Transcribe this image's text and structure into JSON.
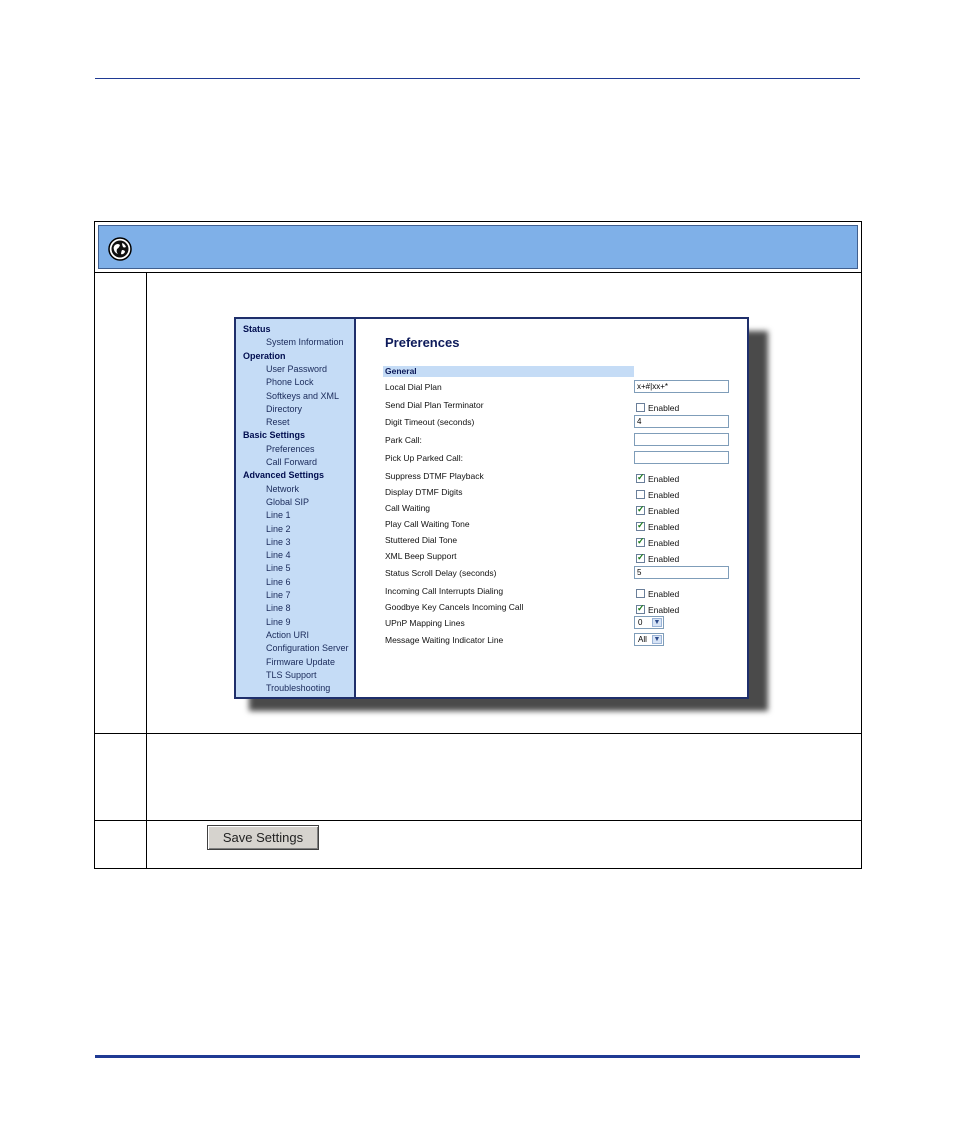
{
  "sidebar": {
    "groups": [
      {
        "label": "Status",
        "items": [
          "System Information"
        ]
      },
      {
        "label": "Operation",
        "items": [
          "User Password",
          "Phone Lock",
          "Softkeys and XML",
          "Directory",
          "Reset"
        ]
      },
      {
        "label": "Basic Settings",
        "items": [
          "Preferences",
          "Call Forward"
        ]
      },
      {
        "label": "Advanced Settings",
        "items": [
          "Network",
          "Global SIP",
          "Line 1",
          "Line 2",
          "Line 3",
          "Line 4",
          "Line 5",
          "Line 6",
          "Line 7",
          "Line 8",
          "Line 9",
          "Action URI",
          "Configuration Server",
          "Firmware Update",
          "TLS Support",
          "Troubleshooting"
        ]
      }
    ]
  },
  "main": {
    "title": "Preferences",
    "section": "General",
    "checkbox_label": "Enabled",
    "fields": [
      {
        "label": "Local Dial Plan",
        "kind": "text",
        "value": "x+#|xx+*"
      },
      {
        "label": "Send Dial Plan Terminator",
        "kind": "check",
        "checked": false
      },
      {
        "label": "Digit Timeout (seconds)",
        "kind": "text",
        "value": "4"
      },
      {
        "label": "Park Call:",
        "kind": "text",
        "value": ""
      },
      {
        "label": "Pick Up Parked Call:",
        "kind": "text",
        "value": ""
      },
      {
        "label": "Suppress DTMF Playback",
        "kind": "check",
        "checked": true
      },
      {
        "label": "Display DTMF Digits",
        "kind": "check",
        "checked": false
      },
      {
        "label": "Call Waiting",
        "kind": "check",
        "checked": true
      },
      {
        "label": "Play Call Waiting Tone",
        "kind": "check",
        "checked": true
      },
      {
        "label": "Stuttered Dial Tone",
        "kind": "check",
        "checked": true
      },
      {
        "label": "XML Beep Support",
        "kind": "check",
        "checked": true
      },
      {
        "label": "Status Scroll Delay (seconds)",
        "kind": "text",
        "value": "5"
      },
      {
        "label": "Incoming Call Interrupts Dialing",
        "kind": "check",
        "checked": false
      },
      {
        "label": "Goodbye Key Cancels Incoming Call",
        "kind": "check",
        "checked": true
      },
      {
        "label": "UPnP Mapping Lines",
        "kind": "select",
        "value": "0"
      },
      {
        "label": "Message Waiting Indicator Line",
        "kind": "select",
        "value": "All"
      }
    ]
  },
  "save_button_label": "Save Settings",
  "icons": {
    "header": "globe-icon"
  },
  "colors": {
    "header_band": "#7fb0e8",
    "sidebar_bg": "#c5dcf6",
    "rule": "#1f3a93"
  }
}
